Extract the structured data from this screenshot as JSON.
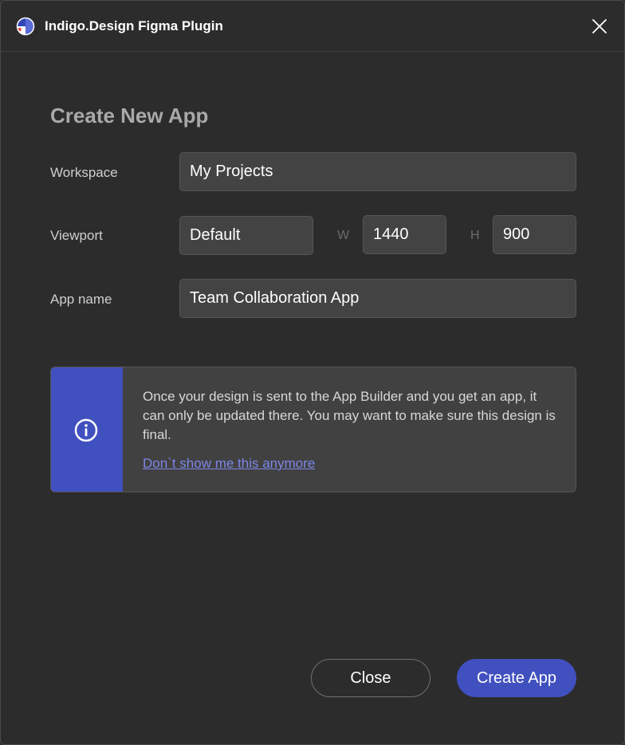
{
  "window": {
    "title": "Indigo.Design Figma Plugin",
    "logo_icon": "indigo-design-logo-icon",
    "close_icon": "close-icon"
  },
  "form": {
    "heading": "Create New App",
    "workspace": {
      "label": "Workspace",
      "value": "My Projects"
    },
    "viewport": {
      "label": "Viewport",
      "preset": "Default",
      "width_label": "W",
      "width_value": "1440",
      "height_label": "H",
      "height_value": "900"
    },
    "app_name": {
      "label": "App name",
      "value": "Team Collaboration App"
    }
  },
  "notice": {
    "icon": "info-icon",
    "text": "Once your design is sent to the App Builder and you get an app, it can only be updated there. You may want to make sure this design is final.",
    "link": "Don`t show me this anymore"
  },
  "footer": {
    "close_label": "Close",
    "create_label": "Create App"
  },
  "colors": {
    "background": "#2c2c2c",
    "field": "#434343",
    "accent": "#4150bf",
    "link": "#7d86e6"
  }
}
